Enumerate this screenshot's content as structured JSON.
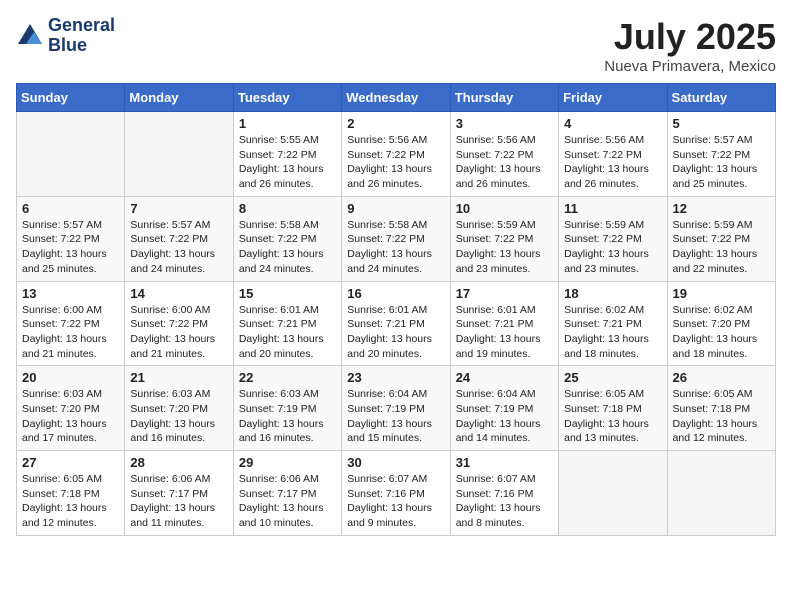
{
  "header": {
    "logo_line1": "General",
    "logo_line2": "Blue",
    "month": "July 2025",
    "location": "Nueva Primavera, Mexico"
  },
  "weekdays": [
    "Sunday",
    "Monday",
    "Tuesday",
    "Wednesday",
    "Thursday",
    "Friday",
    "Saturday"
  ],
  "weeks": [
    [
      {
        "day": "",
        "info": ""
      },
      {
        "day": "",
        "info": ""
      },
      {
        "day": "1",
        "info": "Sunrise: 5:55 AM\nSunset: 7:22 PM\nDaylight: 13 hours and 26 minutes."
      },
      {
        "day": "2",
        "info": "Sunrise: 5:56 AM\nSunset: 7:22 PM\nDaylight: 13 hours and 26 minutes."
      },
      {
        "day": "3",
        "info": "Sunrise: 5:56 AM\nSunset: 7:22 PM\nDaylight: 13 hours and 26 minutes."
      },
      {
        "day": "4",
        "info": "Sunrise: 5:56 AM\nSunset: 7:22 PM\nDaylight: 13 hours and 26 minutes."
      },
      {
        "day": "5",
        "info": "Sunrise: 5:57 AM\nSunset: 7:22 PM\nDaylight: 13 hours and 25 minutes."
      }
    ],
    [
      {
        "day": "6",
        "info": "Sunrise: 5:57 AM\nSunset: 7:22 PM\nDaylight: 13 hours and 25 minutes."
      },
      {
        "day": "7",
        "info": "Sunrise: 5:57 AM\nSunset: 7:22 PM\nDaylight: 13 hours and 24 minutes."
      },
      {
        "day": "8",
        "info": "Sunrise: 5:58 AM\nSunset: 7:22 PM\nDaylight: 13 hours and 24 minutes."
      },
      {
        "day": "9",
        "info": "Sunrise: 5:58 AM\nSunset: 7:22 PM\nDaylight: 13 hours and 24 minutes."
      },
      {
        "day": "10",
        "info": "Sunrise: 5:59 AM\nSunset: 7:22 PM\nDaylight: 13 hours and 23 minutes."
      },
      {
        "day": "11",
        "info": "Sunrise: 5:59 AM\nSunset: 7:22 PM\nDaylight: 13 hours and 23 minutes."
      },
      {
        "day": "12",
        "info": "Sunrise: 5:59 AM\nSunset: 7:22 PM\nDaylight: 13 hours and 22 minutes."
      }
    ],
    [
      {
        "day": "13",
        "info": "Sunrise: 6:00 AM\nSunset: 7:22 PM\nDaylight: 13 hours and 21 minutes."
      },
      {
        "day": "14",
        "info": "Sunrise: 6:00 AM\nSunset: 7:22 PM\nDaylight: 13 hours and 21 minutes."
      },
      {
        "day": "15",
        "info": "Sunrise: 6:01 AM\nSunset: 7:21 PM\nDaylight: 13 hours and 20 minutes."
      },
      {
        "day": "16",
        "info": "Sunrise: 6:01 AM\nSunset: 7:21 PM\nDaylight: 13 hours and 20 minutes."
      },
      {
        "day": "17",
        "info": "Sunrise: 6:01 AM\nSunset: 7:21 PM\nDaylight: 13 hours and 19 minutes."
      },
      {
        "day": "18",
        "info": "Sunrise: 6:02 AM\nSunset: 7:21 PM\nDaylight: 13 hours and 18 minutes."
      },
      {
        "day": "19",
        "info": "Sunrise: 6:02 AM\nSunset: 7:20 PM\nDaylight: 13 hours and 18 minutes."
      }
    ],
    [
      {
        "day": "20",
        "info": "Sunrise: 6:03 AM\nSunset: 7:20 PM\nDaylight: 13 hours and 17 minutes."
      },
      {
        "day": "21",
        "info": "Sunrise: 6:03 AM\nSunset: 7:20 PM\nDaylight: 13 hours and 16 minutes."
      },
      {
        "day": "22",
        "info": "Sunrise: 6:03 AM\nSunset: 7:19 PM\nDaylight: 13 hours and 16 minutes."
      },
      {
        "day": "23",
        "info": "Sunrise: 6:04 AM\nSunset: 7:19 PM\nDaylight: 13 hours and 15 minutes."
      },
      {
        "day": "24",
        "info": "Sunrise: 6:04 AM\nSunset: 7:19 PM\nDaylight: 13 hours and 14 minutes."
      },
      {
        "day": "25",
        "info": "Sunrise: 6:05 AM\nSunset: 7:18 PM\nDaylight: 13 hours and 13 minutes."
      },
      {
        "day": "26",
        "info": "Sunrise: 6:05 AM\nSunset: 7:18 PM\nDaylight: 13 hours and 12 minutes."
      }
    ],
    [
      {
        "day": "27",
        "info": "Sunrise: 6:05 AM\nSunset: 7:18 PM\nDaylight: 13 hours and 12 minutes."
      },
      {
        "day": "28",
        "info": "Sunrise: 6:06 AM\nSunset: 7:17 PM\nDaylight: 13 hours and 11 minutes."
      },
      {
        "day": "29",
        "info": "Sunrise: 6:06 AM\nSunset: 7:17 PM\nDaylight: 13 hours and 10 minutes."
      },
      {
        "day": "30",
        "info": "Sunrise: 6:07 AM\nSunset: 7:16 PM\nDaylight: 13 hours and 9 minutes."
      },
      {
        "day": "31",
        "info": "Sunrise: 6:07 AM\nSunset: 7:16 PM\nDaylight: 13 hours and 8 minutes."
      },
      {
        "day": "",
        "info": ""
      },
      {
        "day": "",
        "info": ""
      }
    ]
  ]
}
